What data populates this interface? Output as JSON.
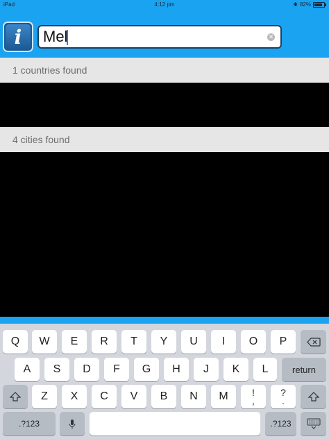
{
  "status_bar": {
    "carrier": "iPad",
    "time": "4:12 pm",
    "battery_percent": "82%",
    "battery_level": 0.82
  },
  "search": {
    "value": "Mel"
  },
  "sections": {
    "countries": {
      "label": "1 countries found"
    },
    "cities": {
      "label": "4 cities found"
    }
  },
  "keyboard": {
    "row1": [
      "Q",
      "W",
      "E",
      "R",
      "T",
      "Y",
      "U",
      "I",
      "O",
      "P"
    ],
    "row2": [
      "A",
      "S",
      "D",
      "F",
      "G",
      "H",
      "J",
      "K",
      "L"
    ],
    "return_label": "return",
    "row3": [
      "Z",
      "X",
      "C",
      "V",
      "B",
      "N",
      "M"
    ],
    "exclaim_top": "!",
    "exclaim_bottom": ",",
    "question_top": "?",
    "question_bottom": ".",
    "numbers_label": ".?123",
    "icons": {
      "backspace": "backspace-icon",
      "shift": "shift-icon",
      "mic": "microphone-icon",
      "hide": "keyboard-hide-icon"
    }
  },
  "colors": {
    "header": "#19a3f0",
    "section_bg": "#e6e6e6",
    "keyboard_bg": "#d3d6dc"
  }
}
